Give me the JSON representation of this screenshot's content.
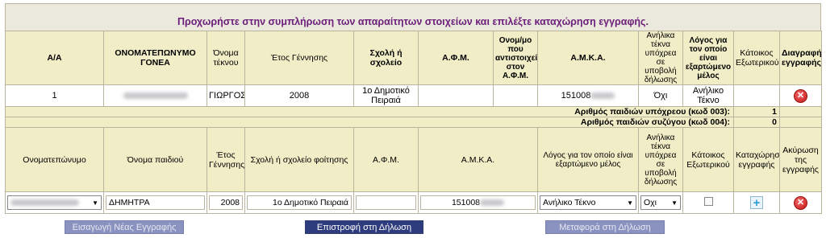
{
  "banner": {
    "text": "Προχωρήστε στην συμπλήρωση των απαραίτητων στοιχείων και επιλέξτε καταχώρηση εγγραφής."
  },
  "columns": {
    "aa": "Α/Α",
    "parent_name": "ΟΝΟΜΑΤΕΠΩΝΥΜΟ ΓΟΝΕΑ",
    "child_name": "Όνομα τέκνου",
    "birth_year": "Έτος Γέννησης",
    "school": "Σχολή ή σχολείο",
    "afm": "Α.Φ.Μ.",
    "corresp_name": "Ονομ/μο που αντιστοιχεί στον Α.Φ.Μ.",
    "amka": "Α.Μ.Κ.Α.",
    "minor_in_decl": "Ανήλικα τέκνα υπόχρεα σε υποβολή δήλωσης",
    "reason": "Λόγος για τον οποίο είναι εξαρτώμενο μέλος",
    "abroad": "Κάτοικος Εξωτερικού",
    "delete": "Διαγραφή εγγραφής"
  },
  "row": {
    "aa": "1",
    "child_name": "ΓΙΩΡΓΟΣ",
    "birth_year": "2008",
    "school": "1ο Δημοτικό Πειραιά",
    "amka_prefix": "151008",
    "minor_in_decl": "Όχι",
    "reason": "Ανήλικο Τέκνο"
  },
  "totals": [
    {
      "label": "Αριθμός παιδιών υπόχρεου (κωδ 003):",
      "value": "1"
    },
    {
      "label": "Αριθμός παιδιών συζύγου (κωδ 004):",
      "value": "0"
    }
  ],
  "form_columns": {
    "full_name": "Ονοματεπώνυμο",
    "child_name": "Όνομα παιδιού",
    "birth_year": "Έτος Γέννησης",
    "school": "Σχολή ή σχολείο φοίτησης",
    "afm": "Α.Φ.Μ.",
    "amka": "Α.Μ.Κ.Α.",
    "minor_in_decl": "Ανήλικα τέκνα υπόχρεα σε υποβολή δήλωσης",
    "reason": "Λόγος για τον οποίο είναι εξαρτώμενο μέλος",
    "abroad": "Κάτοικος Εξωτερικού",
    "register": "Καταχώρηση εγγραφής",
    "cancel": "Ακύρωση της εγγραφής"
  },
  "form": {
    "child_name": "ΔΗΜΗΤΡΑ",
    "birth_year": "2008",
    "school": "1ο Δημοτικό Πειραιά",
    "amka_prefix": "151008",
    "minor_in_decl": "Οχι",
    "reason": "Ανήλικο Τέκνο"
  },
  "buttons": {
    "new_entry": "Εισαγωγή Νέας Εγγραφής",
    "back": "Επιστροφή στη Δήλωση",
    "transfer": "Μεταφορά στη Δήλωση"
  },
  "icons": {
    "delete": "delete-icon",
    "add": "add-icon",
    "dropdown": "chevron-down-icon"
  },
  "colors": {
    "banner_text": "#6b1d7a",
    "header_bg": "#f1edc6",
    "button_active": "#2e3b7c",
    "button_disabled": "#8a93bf"
  }
}
